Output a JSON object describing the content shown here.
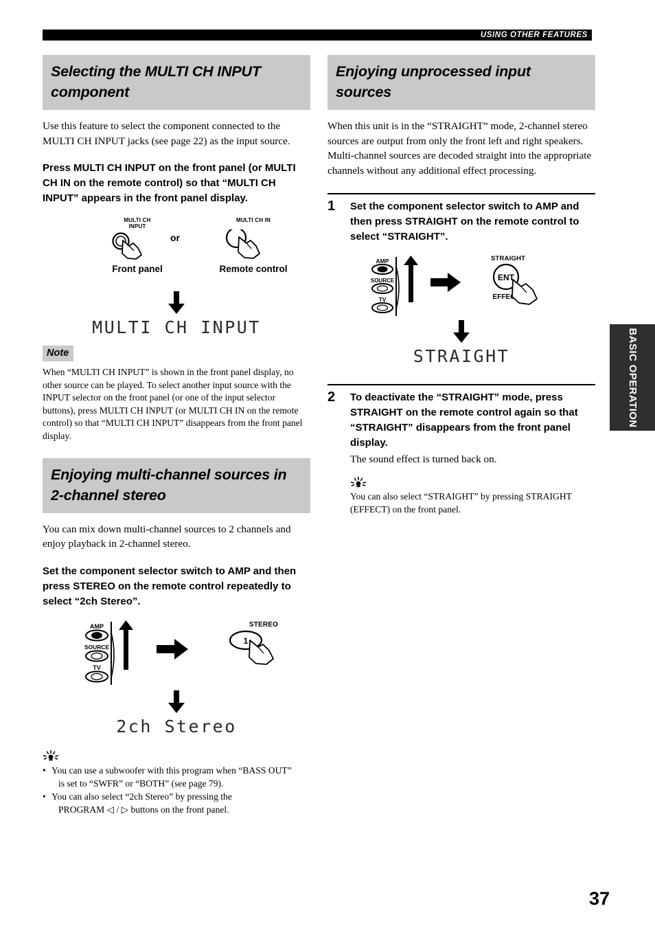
{
  "running_head": "USING OTHER FEATURES",
  "page_number": "37",
  "side_tab": "BASIC OPERATION",
  "left_column": {
    "section1": {
      "heading_line1": "Selecting the MULTI CH INPUT",
      "heading_line2": "component",
      "intro": "Use this feature to select the component connected to the MULTI CH INPUT jacks (see page 22) as the input source.",
      "instruction": "Press MULTI CH INPUT on the front panel (or MULTI CH IN on the remote control) so that “MULTI CH INPUT” appears in the front panel display.",
      "figure": {
        "front_button_label_line1": "MULTI CH",
        "front_button_label_line2": "INPUT",
        "or_label": "or",
        "remote_button_label": "MULTI CH IN",
        "front_caption": "Front panel",
        "remote_caption": "Remote control",
        "display_text": "MULTI CH INPUT"
      },
      "note_tag": "Note",
      "note_text": "When “MULTI CH INPUT” is shown in the front panel display, no other source can be played. To select another input source with the INPUT selector on the front panel (or one of the input selector buttons), press MULTI CH INPUT (or MULTI CH IN on the remote control) so that “MULTI CH INPUT” disappears from the front panel display."
    },
    "section2": {
      "heading_line1": "Enjoying multi-channel sources in",
      "heading_line2": "2-channel stereo",
      "intro": "You can mix down multi-channel sources to 2 channels and enjoy playback in 2-channel stereo.",
      "instruction": "Set the component selector switch to AMP and then press STEREO on the remote control repeatedly to select “2ch Stereo”.",
      "figure": {
        "switch_amp": "AMP",
        "switch_source": "SOURCE",
        "switch_tv": "TV",
        "button_label": "STEREO",
        "button_inner": "1",
        "display_text": "2ch Stereo"
      },
      "tips": [
        {
          "line1": "You can use a subwoofer with this program when “BASS OUT”",
          "line2": "is set to “SWFR” or “BOTH” (see page 79)."
        },
        {
          "line1": "You can also select “2ch Stereo” by pressing the",
          "line2": "PROGRAM ◁ / ▷ buttons on the front panel."
        }
      ]
    }
  },
  "right_column": {
    "section1": {
      "heading_line1": "Enjoying unprocessed input",
      "heading_line2": "sources",
      "intro": "When this unit is in the “STRAIGHT” mode, 2-channel stereo sources are output from only the front left and right speakers. Multi-channel sources are decoded straight into the appropriate channels without any additional effect processing.",
      "steps": [
        {
          "number": "1",
          "text": "Set the component selector switch to AMP and then press STRAIGHT on the remote control to select “STRAIGHT”.",
          "figure": {
            "switch_amp": "AMP",
            "switch_source": "SOURCE",
            "switch_tv": "TV",
            "button_label": "STRAIGHT",
            "button_inner": "ENT",
            "button_sub": "EFFECT",
            "display_text": "STRAIGHT"
          }
        },
        {
          "number": "2",
          "text": "To deactivate the “STRAIGHT” mode, press STRAIGHT on the remote control again so that “STRAIGHT” disappears from the front panel display.",
          "subtext": "The sound effect is turned back on.",
          "tip": "You can also select “STRAIGHT” by pressing STRAIGHT (EFFECT) on the front panel."
        }
      ]
    }
  },
  "colors": {
    "heading_background": "#c9c9c9",
    "running_head_background": "#000000",
    "side_tab_background": "#2f2f2f"
  }
}
